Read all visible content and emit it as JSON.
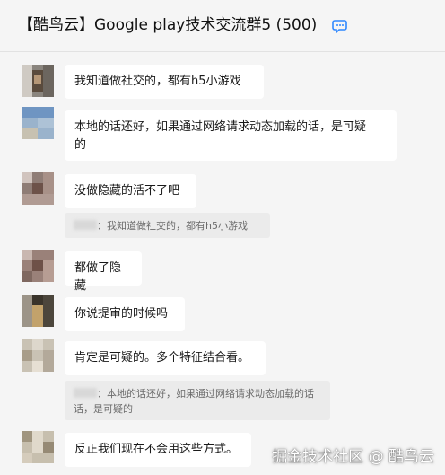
{
  "header": {
    "title": "【酷鸟云】Google play技术交流群5 (500)",
    "chat_icon": "chat-bubble-icon"
  },
  "messages": [
    {
      "text": "我知道做社交的，都有h5小游戏"
    },
    {
      "text_line1": "本地的话还好，如果通过网络请求动态加载的话，是可疑",
      "text_line2": "的"
    },
    {
      "text": "没做隐藏的活不了吧",
      "quote": "：我知道做社交的，都有h5小游戏"
    },
    {
      "text": "都做了隐藏"
    },
    {
      "text": "你说提审的时候吗"
    },
    {
      "text": "肯定是可疑的。多个特征结合看。",
      "quote_line1": "：本地的话还好，如果通过网络请求动态加载的话",
      "quote_line2": "话，是可疑的"
    },
    {
      "text": "反正我们现在不会用这些方式。"
    }
  ],
  "watermark": "掘金技术社区 @ 酷鸟云",
  "colors": {
    "background": "#f5f5f5",
    "bubble": "#ffffff",
    "quote": "#ebebeb",
    "chat_icon_accent": "#2f88ff"
  }
}
